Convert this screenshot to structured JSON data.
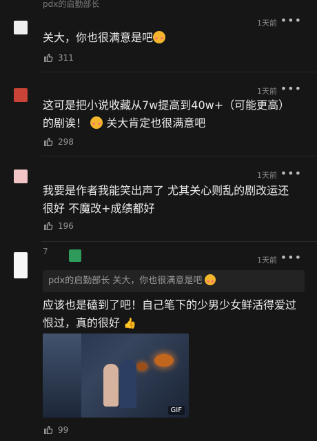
{
  "comments": [
    {
      "username": "pdx的启勤部长",
      "time": "1天前",
      "more": "•••",
      "text_a": "关大，你也很满意是吧",
      "likes": "311",
      "avatar_color": "#eeeeee"
    },
    {
      "username": "",
      "time": "1天前",
      "more": "•••",
      "text_a": "这可是把小说收藏从7w提高到40w+（可能更高）",
      "text_b": "的剧诶！",
      "text_c": "关大肯定也很满意吧",
      "likes": "298",
      "avatar_color": "#c94336"
    },
    {
      "username": "",
      "time": "1天前",
      "more": "•••",
      "text_a": "我要是作者我能笑出声了 尤其关心则乱的剧改运还",
      "text_b": "很好 不魔改+成绩都好",
      "likes": "196",
      "avatar_color": "#f1c5c5"
    },
    {
      "username": "7",
      "time": "1天前",
      "more": "•••",
      "quote": "pdx的启勤部长 关大，你也很满意是吧",
      "text_a": "应该也是磕到了吧！自己笔下的少男少女鲜活得爱过",
      "text_b": "恨过，真的很好",
      "gif_label": "GIF",
      "likes": "99",
      "avatar_color": "#f7f7f7",
      "badge_color": "#2f9b5a"
    }
  ],
  "icons": {
    "like": "thumbs-up-icon",
    "more": "more-horizontal-icon"
  }
}
